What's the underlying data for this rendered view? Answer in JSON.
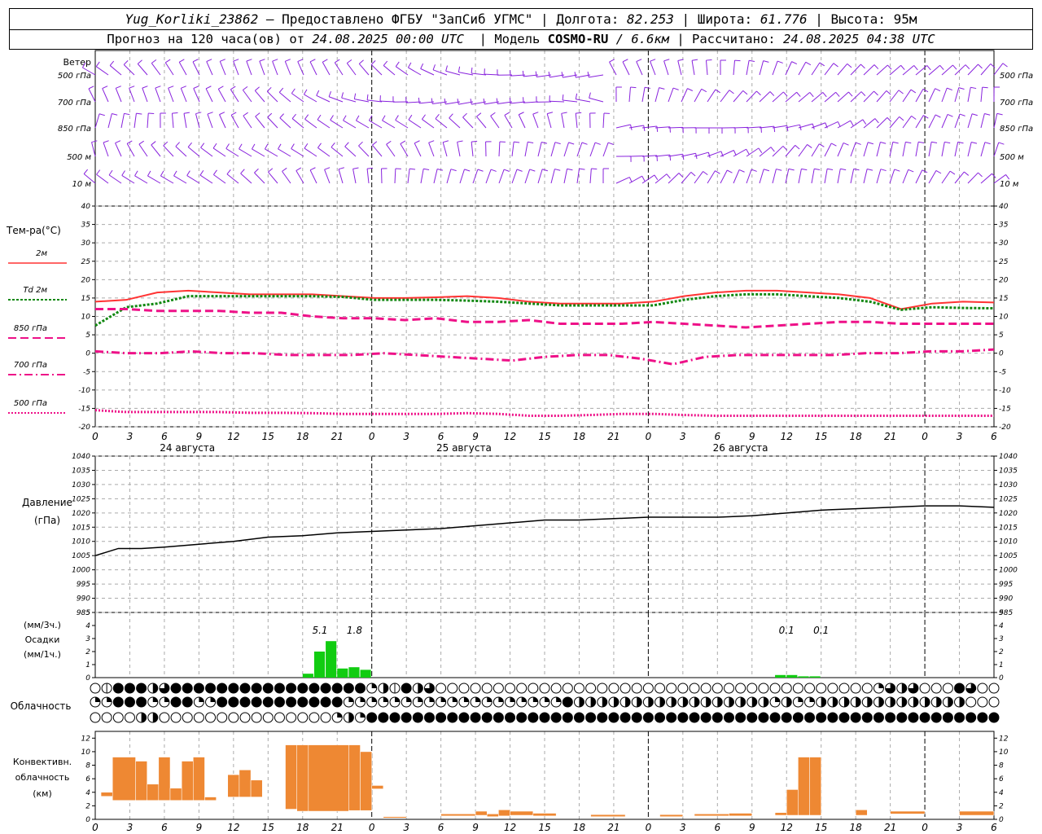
{
  "header": {
    "station": "Yug_Korliki_23862",
    "provider": "– Предоставлено ФГБУ \"ЗапСиб УГМС\"",
    "lon_label": "Долгота:",
    "lon": "82.253",
    "lat_label": "Широта:",
    "lat": "61.776",
    "alt_label": "Высота:",
    "alt": "95м",
    "forecast_label": "Прогноз на 120 часа(ов) от",
    "forecast_from": "24.08.2025 00:00 UTC",
    "model_label": "Модель",
    "model": "COSMO-RU",
    "resolution": "/ 6.6км",
    "calc_label": "Рассчитано:",
    "calc_time": "24.08.2025 04:38 UTC"
  },
  "labels": {
    "wind": "Ветер",
    "wind_levels": [
      "500 гПа",
      "700 гПа",
      "850 гПа",
      "500 м",
      "10 м"
    ],
    "temp": "Тем-ра(°C)",
    "temp_legend": [
      "2м",
      "Td  2м",
      "850 гПа",
      "700 гПа",
      "500 гПа"
    ],
    "pressure": [
      "Давление",
      "(гПа)"
    ],
    "precip": [
      "(мм/3ч.)",
      "Осадки",
      "(мм/1ч.)"
    ],
    "clouds": "Облачность",
    "conv": [
      "Конвективн.",
      "облачность",
      "(км)"
    ],
    "dates": [
      "24 августа",
      "25 августа",
      "26 августа"
    ]
  },
  "hour_ticks": [
    "0",
    "3",
    "6",
    "9",
    "12",
    "15",
    "18",
    "21",
    "0",
    "3",
    "6",
    "9",
    "12",
    "15",
    "18",
    "21",
    "0",
    "3",
    "6",
    "9",
    "12",
    "15",
    "18",
    "21",
    "0",
    "3",
    "6"
  ],
  "colors": {
    "t2m": "#ff3333",
    "td2m": "#118811",
    "t850": "#ee1188",
    "t700": "#ee1188",
    "t500": "#ee1188",
    "wind": "#8822dd",
    "precip": "#11cc11",
    "conv": "#ee8833"
  },
  "chart_data": [
    {
      "type": "line",
      "title": "Тем-ра(°C)",
      "x_unit": "hours from 24.08.2025 00:00 UTC",
      "ylim": [
        -20,
        40
      ],
      "y_ticks": [
        -20,
        -15,
        -10,
        -5,
        0,
        5,
        10,
        15,
        20,
        25,
        30,
        35,
        40
      ],
      "x": [
        0,
        3,
        6,
        9,
        12,
        15,
        18,
        21,
        24,
        27,
        30,
        33,
        36,
        39,
        42,
        45,
        48,
        51,
        54,
        57,
        60,
        63,
        66,
        69,
        72,
        75,
        78
      ],
      "series": [
        {
          "name": "2м",
          "values": [
            14,
            14.5,
            16.5,
            17,
            16.5,
            16,
            16,
            16,
            15.5,
            15,
            15,
            15.2,
            15.5,
            15,
            14,
            13.5,
            13.5,
            13.5,
            14,
            15.5,
            16.5,
            17,
            17,
            16.5,
            16,
            15,
            12,
            13.5,
            14,
            13.8
          ]
        },
        {
          "name": "Td 2м",
          "values": [
            7.5,
            12.5,
            13.5,
            15.5,
            15.5,
            15.5,
            15.5,
            15.5,
            15.3,
            14.5,
            14.5,
            14.5,
            14.3,
            14,
            13.5,
            13,
            13,
            13,
            13,
            14.5,
            15.5,
            16,
            16,
            15.5,
            15,
            14,
            11.8,
            12.5,
            12.3,
            12.2
          ]
        },
        {
          "name": "850 гПа",
          "values": [
            12,
            12,
            11.5,
            11.5,
            11.5,
            11,
            11,
            10,
            9.5,
            9.5,
            9,
            9.5,
            8.5,
            8.5,
            9,
            8,
            8,
            8,
            8.5,
            8,
            7.5,
            7,
            7.5,
            8,
            8.5,
            8.5,
            8,
            8,
            8,
            8
          ]
        },
        {
          "name": "700 гПа",
          "values": [
            0.5,
            0,
            0,
            0.5,
            0,
            0,
            -0.5,
            -0.5,
            -0.5,
            0,
            -0.5,
            -1,
            -1.5,
            -2,
            -1,
            -0.5,
            -0.5,
            -1.5,
            -3,
            -1,
            -0.5,
            -0.5,
            -0.5,
            -0.5,
            0,
            0,
            0.5,
            0.5,
            1
          ]
        },
        {
          "name": "500 гПа",
          "values": [
            -15.5,
            -16,
            -16,
            -16,
            -16,
            -16.2,
            -16.2,
            -16.3,
            -16.5,
            -16.5,
            -16.5,
            -16.5,
            -16.3,
            -16.5,
            -17,
            -17,
            -16.8,
            -16.5,
            -16.5,
            -16.8,
            -17,
            -17,
            -17,
            -17,
            -17,
            -17,
            -17,
            -17,
            -17,
            -17
          ]
        }
      ]
    },
    {
      "type": "line",
      "title": "Давление (гПа)",
      "ylim": [
        985,
        1040
      ],
      "y_ticks": [
        985,
        990,
        995,
        1000,
        1005,
        1010,
        1015,
        1020,
        1025,
        1030,
        1035,
        1040
      ],
      "series": [
        {
          "name": "Давление",
          "x": [
            0,
            2,
            4,
            6,
            9,
            12,
            15,
            18,
            21,
            24,
            27,
            30,
            33,
            36,
            39,
            42,
            45,
            48,
            51,
            54,
            57,
            60,
            63,
            66,
            69,
            72,
            75,
            78
          ],
          "values": [
            1005,
            1007.5,
            1007.5,
            1008,
            1009,
            1010,
            1011.5,
            1012,
            1013,
            1013.5,
            1014,
            1014.5,
            1015.5,
            1016.5,
            1017.5,
            1017.5,
            1018,
            1018.5,
            1018.5,
            1018.5,
            1019,
            1020,
            1021,
            1021.5,
            1022,
            1022.5,
            1022.5,
            1022
          ]
        }
      ]
    },
    {
      "type": "bar",
      "title": "Осадки (мм/1ч.)",
      "ylim": [
        0,
        5
      ],
      "y_ticks": [
        0,
        1,
        2,
        3,
        4,
        5
      ],
      "annotations": [
        {
          "text": "5.1",
          "x": 19.5
        },
        {
          "text": "1.8",
          "x": 22.5
        },
        {
          "text": "0.1",
          "x": 60
        },
        {
          "text": "0.1",
          "x": 63
        }
      ],
      "x": [
        18,
        19,
        20,
        21,
        22,
        23,
        59,
        60,
        61,
        62
      ],
      "values": [
        0.3,
        2,
        2.8,
        0.7,
        0.8,
        0.6,
        0.2,
        0.2,
        0.1,
        0.1
      ]
    },
    {
      "type": "table",
      "title": "Облачность",
      "rows": [
        "ohfffHbfffffffffffffffffqHhfHbooooooooooooooooooooooooooooooooooooooqbHbooofbooooooooooooooooo",
        "qqfffqqffqqfffffffffffqqqqqqqqqqqqqqqqqqqfHHHHHHHHHHHHHHHHHqHqqHHHHHHHHHHHHHoooooooooooooooooooo",
        "ooooHHoooooooooooooooqHqfffffffffffffffffffffffffffffffffffffffffffffffffffffffffffffffffffff"
      ]
    },
    {
      "type": "bar",
      "title": "Конвективн. облачность (км)",
      "ylim": [
        0,
        13
      ],
      "y_ticks": [
        0,
        2,
        4,
        6,
        8,
        10,
        12
      ],
      "bars": [
        {
          "x": [
            0.5,
            1.5
          ],
          "low": 3.4,
          "high": 4
        },
        {
          "x": [
            1.5,
            3.5
          ],
          "low": 2.8,
          "high": 9.2
        },
        {
          "x": [
            3.5,
            4.5
          ],
          "low": 2.8,
          "high": 8.6
        },
        {
          "x": [
            4.5,
            5.5
          ],
          "low": 2.8,
          "high": 5.2
        },
        {
          "x": [
            5.5,
            6.5
          ],
          "low": 2.8,
          "high": 9.2
        },
        {
          "x": [
            6.5,
            7.5
          ],
          "low": 2.8,
          "high": 4.6
        },
        {
          "x": [
            7.5,
            8.5
          ],
          "low": 2.8,
          "high": 8.6
        },
        {
          "x": [
            8.5,
            9.5
          ],
          "low": 2.8,
          "high": 9.2
        },
        {
          "x": [
            9.5,
            10.5
          ],
          "low": 2.8,
          "high": 3.3
        },
        {
          "x": [
            11.5,
            12.5
          ],
          "low": 3.3,
          "high": 6.6
        },
        {
          "x": [
            12.5,
            13.5
          ],
          "low": 3.3,
          "high": 7.3
        },
        {
          "x": [
            13.5,
            14.5
          ],
          "low": 3.3,
          "high": 5.8
        },
        {
          "x": [
            16.5,
            17.5
          ],
          "low": 1.5,
          "high": 11
        },
        {
          "x": [
            17.5,
            18.5
          ],
          "low": 1.2,
          "high": 11
        },
        {
          "x": [
            18.5,
            22
          ],
          "low": 1.2,
          "high": 11
        },
        {
          "x": [
            22,
            23
          ],
          "low": 1.3,
          "high": 11
        },
        {
          "x": [
            23,
            24
          ],
          "low": 1.3,
          "high": 10
        },
        {
          "x": [
            24,
            25
          ],
          "low": 4.5,
          "high": 5
        },
        {
          "x": [
            25,
            27
          ],
          "low": 0.2,
          "high": 0.4
        },
        {
          "x": [
            30,
            33
          ],
          "low": 0.5,
          "high": 0.8
        },
        {
          "x": [
            33,
            34
          ],
          "low": 0.6,
          "high": 1.2
        },
        {
          "x": [
            34,
            35
          ],
          "low": 0.4,
          "high": 0.8
        },
        {
          "x": [
            35,
            36
          ],
          "low": 0.5,
          "high": 1.4
        },
        {
          "x": [
            36,
            38
          ],
          "low": 0.6,
          "high": 1.2
        },
        {
          "x": [
            38,
            40
          ],
          "low": 0.5,
          "high": 0.9
        },
        {
          "x": [
            43,
            46
          ],
          "low": 0.4,
          "high": 0.7
        },
        {
          "x": [
            49,
            51
          ],
          "low": 0.4,
          "high": 0.7
        },
        {
          "x": [
            52,
            55
          ],
          "low": 0.5,
          "high": 0.8
        },
        {
          "x": [
            55,
            57
          ],
          "low": 0.5,
          "high": 0.9
        },
        {
          "x": [
            59,
            60
          ],
          "low": 0.6,
          "high": 1
        },
        {
          "x": [
            60,
            61
          ],
          "low": 0.6,
          "high": 4.4
        },
        {
          "x": [
            61,
            62
          ],
          "low": 0.6,
          "high": 9.2
        },
        {
          "x": [
            62,
            63
          ],
          "low": 0.6,
          "high": 9.2
        },
        {
          "x": [
            66,
            67
          ],
          "low": 0.6,
          "high": 1.4
        },
        {
          "x": [
            69,
            72
          ],
          "low": 0.8,
          "high": 1.2
        },
        {
          "x": [
            75,
            78
          ],
          "low": 0.6,
          "high": 1.2
        }
      ]
    },
    {
      "type": "scatter",
      "title": "Ветер",
      "levels": [
        "500 гПа",
        "700 гПа",
        "850 гПа",
        "500 м",
        "10 м"
      ],
      "note": "wind barbs at every model hour for each level"
    }
  ]
}
